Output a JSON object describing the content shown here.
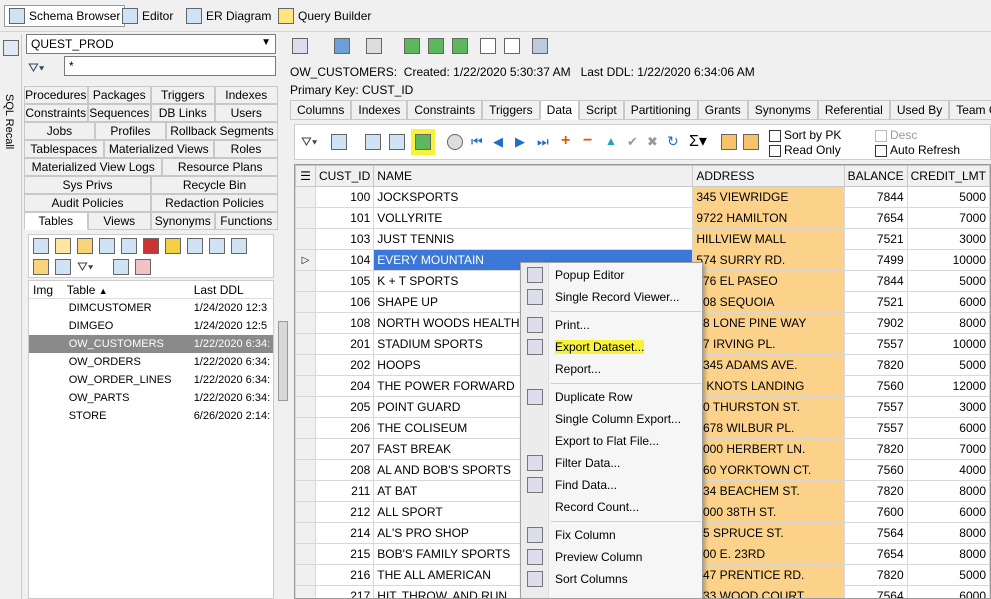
{
  "toolbar": {
    "items": [
      {
        "label": "Schema Browser",
        "icon": "schema-browser-icon"
      },
      {
        "label": "Editor",
        "icon": "editor-icon"
      },
      {
        "label": "ER Diagram",
        "icon": "er-diagram-icon"
      },
      {
        "label": "Query Builder",
        "icon": "query-builder-icon"
      }
    ]
  },
  "sql_recall": {
    "label": "SQL Recall"
  },
  "left": {
    "schema": "QUEST_PROD",
    "filter_value": "*",
    "tab_rows": [
      [
        "Procedures",
        "Packages",
        "Triggers",
        "Indexes"
      ],
      [
        "Constraints",
        "Sequences",
        "DB Links",
        "Users"
      ],
      [
        "Jobs",
        "Profiles",
        "Rollback Segments"
      ],
      [
        "Tablespaces",
        "Materialized Views",
        "Roles"
      ],
      [
        "Materialized View Logs",
        "Resource Plans"
      ],
      [
        "Sys Privs",
        "Recycle Bin"
      ],
      [
        "Audit Policies",
        "Redaction Policies"
      ],
      [
        "Tables",
        "Views",
        "Synonyms",
        "Functions"
      ]
    ],
    "tree_headers": {
      "img": "Img",
      "table": "Table",
      "last_ddl": "Last DDL"
    },
    "tables": [
      {
        "name": "DIMCUSTOMER",
        "ddl": "1/24/2020 12:3"
      },
      {
        "name": "DIMGEO",
        "ddl": "1/24/2020 12:5"
      },
      {
        "name": "OW_CUSTOMERS",
        "ddl": "1/22/2020 6:34:"
      },
      {
        "name": "OW_ORDERS",
        "ddl": "1/22/2020 6:34:"
      },
      {
        "name": "OW_ORDER_LINES",
        "ddl": "1/22/2020 6:34:"
      },
      {
        "name": "OW_PARTS",
        "ddl": "1/22/2020 6:34:"
      },
      {
        "name": "STORE",
        "ddl": "6/26/2020 2:14:"
      }
    ]
  },
  "right": {
    "info_line": "OW_CUSTOMERS:  Created: 1/22/2020 5:30:37 AM   Last DDL: 1/22/2020 6:34:06 AM",
    "primary_key": "Primary Key:  CUST_ID",
    "tabs": [
      "Columns",
      "Indexes",
      "Constraints",
      "Triggers",
      "Data",
      "Script",
      "Partitioning",
      "Grants",
      "Synonyms",
      "Referential",
      "Used By",
      "Team Coding"
    ],
    "options": {
      "sort_by_pk": "Sort by PK",
      "read_only": "Read Only",
      "desc": "Desc",
      "auto_refresh": "Auto Refresh"
    },
    "columns": [
      "CUST_ID",
      "NAME",
      "ADDRESS",
      "BALANCE",
      "CREDIT_LMT"
    ],
    "rows": [
      [
        "100",
        "JOCKSPORTS",
        "345 VIEWRIDGE",
        "7844",
        "5000"
      ],
      [
        "101",
        "VOLLYRITE",
        "9722 HAMILTON",
        "7654",
        "7000"
      ],
      [
        "103",
        "JUST TENNIS",
        "HILLVIEW MALL",
        "7521",
        "3000"
      ],
      [
        "104",
        "EVERY MOUNTAIN",
        "574 SURRY RD.",
        "7499",
        "10000"
      ],
      [
        "105",
        "K + T SPORTS",
        "476 EL PASEO",
        "7844",
        "5000"
      ],
      [
        "106",
        "SHAPE UP",
        "908 SEQUOIA",
        "7521",
        "6000"
      ],
      [
        "108",
        "NORTH WOODS HEALTH A",
        "98 LONE PINE WAY",
        "7902",
        "8000"
      ],
      [
        "201",
        "STADIUM SPORTS",
        "47 IRVING PL.",
        "7557",
        "10000"
      ],
      [
        "202",
        "HOOPS",
        "2345 ADAMS AVE.",
        "7820",
        "5000"
      ],
      [
        "204",
        "THE POWER FORWARD",
        "1 KNOTS LANDING",
        "7560",
        "12000"
      ],
      [
        "205",
        "POINT GUARD",
        "20 THURSTON ST.",
        "7557",
        "3000"
      ],
      [
        "206",
        "THE COLISEUM",
        "5678 WILBUR PL.",
        "7557",
        "6000"
      ],
      [
        "207",
        "FAST BREAK",
        "1000 HERBERT LN.",
        "7820",
        "7000"
      ],
      [
        "208",
        "AL AND BOB'S SPORTS",
        "260 YORKTOWN CT.",
        "7560",
        "4000"
      ],
      [
        "211",
        "AT BAT",
        "234 BEACHEM ST.",
        "7820",
        "8000"
      ],
      [
        "212",
        "ALL SPORT",
        "1000 38TH ST.",
        "7600",
        "6000"
      ],
      [
        "214",
        "AL'S PRO SHOP",
        "45 SPRUCE ST.",
        "7564",
        "8000"
      ],
      [
        "215",
        "BOB'S FAMILY SPORTS",
        "400 E. 23RD",
        "7654",
        "8000"
      ],
      [
        "216",
        "THE ALL AMERICAN",
        "547 PRENTICE RD.",
        "7820",
        "5000"
      ],
      [
        "217",
        "HIT, THROW, AND RUN",
        "333 WOOD COURT",
        "7564",
        "6000"
      ]
    ]
  },
  "context_menu": {
    "items": [
      "Popup Editor",
      "Single Record Viewer...",
      "Print...",
      "Export Dataset...",
      "Report...",
      "Duplicate Row",
      "Single Column Export...",
      "Export to Flat File...",
      "Filter Data...",
      "Find Data...",
      "Record Count...",
      "Fix Column",
      "Preview Column",
      "Sort Columns"
    ]
  },
  "colors": {
    "address_bg": "#fcd28a",
    "highlight": "#f7f23a",
    "selection": "#3c78d8"
  }
}
